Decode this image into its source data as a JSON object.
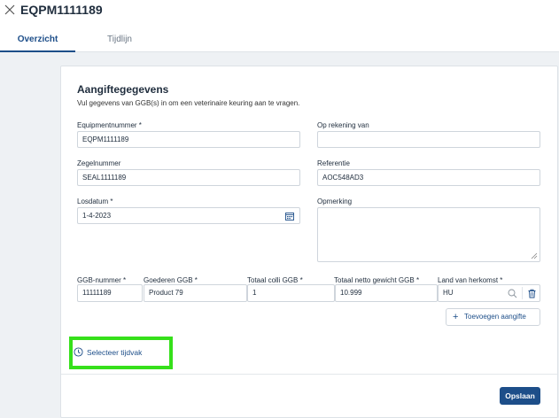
{
  "header": {
    "title": "EQPM1111189"
  },
  "tabs": [
    {
      "label": "Overzicht"
    },
    {
      "label": "Tijdlijn"
    }
  ],
  "form": {
    "title": "Aangiftegegevens",
    "description": "Vul gegevens van GGB(s) in om een veterinaire keuring aan te vragen.",
    "equipmentnummer": {
      "label": "Equipmentnummer *",
      "value": "EQPM1111189"
    },
    "op_rekening_van": {
      "label": "Op rekening van",
      "value": ""
    },
    "zegelnummer": {
      "label": "Zegelnummer",
      "value": "SEAL1111189"
    },
    "referentie": {
      "label": "Referentie",
      "value": "AOC548AD3"
    },
    "losdatum": {
      "label": "Losdatum *",
      "value": "1-4-2023"
    },
    "opmerking": {
      "label": "Opmerking",
      "value": ""
    }
  },
  "ggb": {
    "headers": [
      "GGB-nummer *",
      "Goederen GGB *",
      "Totaal colli GGB *",
      "Totaal netto gewicht GGB *",
      "Land van herkomst *"
    ],
    "row": [
      "11111189",
      "Product 79",
      "1",
      "10.999",
      "HU"
    ]
  },
  "actions": {
    "add_label": "Toevoegen aangifte",
    "tijdvak_label": "Selecteer tijdvak",
    "save_label": "Opslaan"
  },
  "colors": {
    "accent": "#1d4e89",
    "highlight": "#36e01b"
  }
}
